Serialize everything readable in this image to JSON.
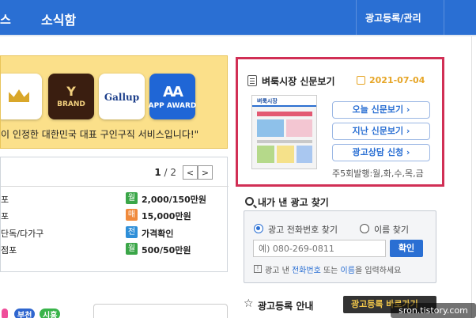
{
  "nav": {
    "left_item": "스",
    "news": "소식함",
    "right_item": "광고등록/관리"
  },
  "banner": {
    "badges": [
      {
        "icon": "crown-icon",
        "label": ""
      },
      {
        "icon": "y-brand-icon",
        "label": "BRAND"
      },
      {
        "icon": "gallup-icon",
        "label": "Gallup"
      },
      {
        "icon": "aa-award-icon",
        "label": "APP AWARD"
      }
    ],
    "slogan": "이 인정한 대한민국 대표 구인구직 서비스입니다!\""
  },
  "listing": {
    "page_current": "1",
    "page_total": "/ 2",
    "prev": "<",
    "next": ">",
    "rows": [
      {
        "name": "포",
        "tag": "월",
        "tag_color": "#3aa648",
        "price": "2,000/150만원"
      },
      {
        "name": "포",
        "tag": "매",
        "tag_color": "#f08a3c",
        "price": "15,000만원"
      },
      {
        "name": "단독/다가구",
        "tag": "전",
        "tag_color": "#2f8fd8",
        "price": "가격확인"
      },
      {
        "name": "점포",
        "tag": "월",
        "tag_color": "#3aa648",
        "price": "500/50만원"
      }
    ]
  },
  "bottom_tags": [
    "",
    "부천",
    "시흥"
  ],
  "paper": {
    "title": "벼룩시장 신문보기",
    "date": "2021-07-04",
    "thumb_masthead": "벼룩시장",
    "btn_today": "오늘 신문보기 ›",
    "btn_past": "지난 신문보기 ›",
    "btn_consult": "광고상담 신청 ›",
    "schedule": "주5회발행:월,화,수,목,금"
  },
  "find": {
    "title": "내가 낸 광고 찾기",
    "radio_phone": "광고 전화번호 찾기",
    "radio_name": "이름 찾기",
    "phone_placeholder": "예) 080-269-0811",
    "ok": "확인",
    "hint_pre": "광고 낸 ",
    "hint_phone": "전화번호",
    "hint_mid": " 또는 ",
    "hint_name": "이름",
    "hint_post": "을 입력하세요"
  },
  "register": {
    "title": "광고등록 안내",
    "btn": "광고등록 바로가기"
  },
  "watermark": "sron.tistory.com",
  "colors": {
    "accent": "#2a6fd3",
    "highlight_border": "#d12f55",
    "date": "#e6a526"
  }
}
